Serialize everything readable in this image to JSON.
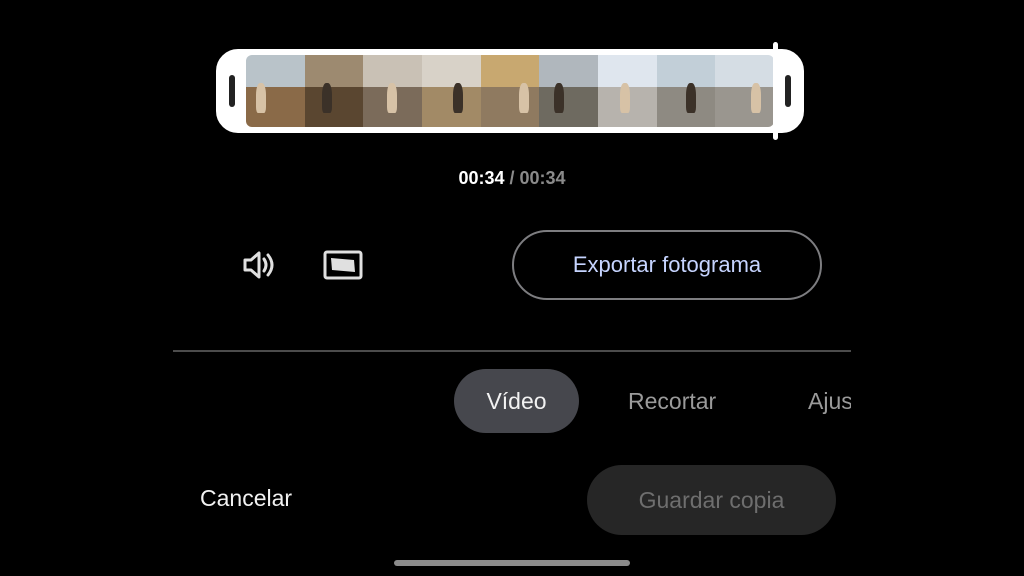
{
  "timeline": {
    "frames": [
      {
        "sky": "#b9c3c9",
        "ground": "#8a6a48"
      },
      {
        "sky": "#9d8a70",
        "ground": "#5a4630"
      },
      {
        "sky": "#c9c1b5",
        "ground": "#7b6b5a"
      },
      {
        "sky": "#d8d2c8",
        "ground": "#a28a66"
      },
      {
        "sky": "#c8a870",
        "ground": "#8f7a60"
      },
      {
        "sky": "#b0b7bd",
        "ground": "#6e6a60"
      },
      {
        "sky": "#dfe6ee",
        "ground": "#b7b3ad"
      },
      {
        "sky": "#c2cfd8",
        "ground": "#8e8a82"
      },
      {
        "sky": "#d5dde4",
        "ground": "#9a968f"
      }
    ]
  },
  "time": {
    "current": "00:34",
    "separator": " / ",
    "total": "00:34"
  },
  "controls": {
    "volume_icon": "volume-icon",
    "aspect_icon": "aspect-ratio-icon"
  },
  "export_button": {
    "label": "Exportar fotograma"
  },
  "tabs": [
    {
      "label": "Vídeo",
      "active": true
    },
    {
      "label": "Recortar"
    },
    {
      "label": "Ajus"
    }
  ],
  "footer": {
    "cancel_label": "Cancelar",
    "save_label": "Guardar copia"
  }
}
